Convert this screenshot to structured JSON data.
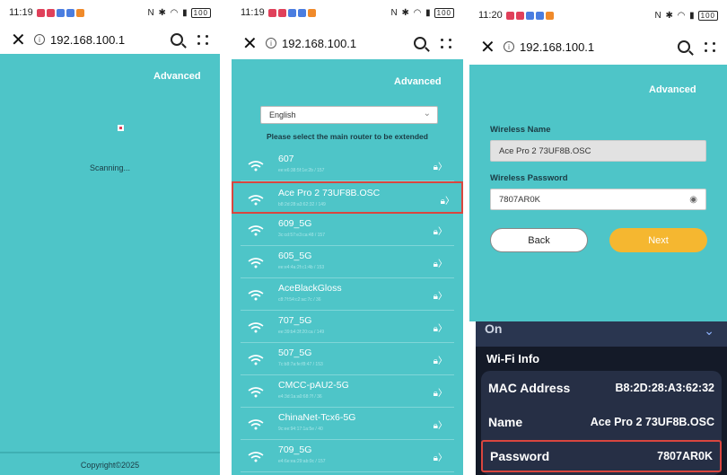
{
  "p1": {
    "time": "11:19",
    "url": "192.168.100.1",
    "advanced": "Advanced",
    "scanning": "Scanning...",
    "copyright": "Copyright©2025"
  },
  "p2": {
    "time": "11:19",
    "url": "192.168.100.1",
    "advanced": "Advanced",
    "language": "English",
    "prompt": "Please select the main router to be extended",
    "networks": [
      {
        "name": "607",
        "mac": "ee:e6:38:5f:1e:2b / 157"
      },
      {
        "name": "Ace Pro 2 73UF8B.OSC",
        "mac": "b8:2d:28:a3:62:32 / 149"
      },
      {
        "name": "609_5G",
        "mac": "3c:cd:57:e3:ca:48 / 157"
      },
      {
        "name": "605_5G",
        "mac": "ee:e4:4a:2f:c1:4b / 153"
      },
      {
        "name": "AceBlackGloss",
        "mac": "c8:7f:54:c2:ac:7c / 36"
      },
      {
        "name": "707_5G",
        "mac": "ee:39:b4:3f:20:ca / 149"
      },
      {
        "name": "507_5G",
        "mac": "7c:b8:7a:fe:f8:47 / 153"
      },
      {
        "name": "CMCC-pAU2-5G",
        "mac": "e4:3d:1a:a0:68:7f / 36"
      },
      {
        "name": "ChinaNet-Tcx6-5G",
        "mac": "9c:ee:94:17:1a:5e / 40"
      },
      {
        "name": "709_5G",
        "mac": "e4:6e:ea:29:ab:0c / 157"
      }
    ]
  },
  "p3": {
    "time": "11:20",
    "url": "192.168.100.1",
    "advanced": "Advanced",
    "wireless_name_label": "Wireless Name",
    "wireless_name_value": "Ace Pro 2 73UF8B.OSC",
    "wireless_password_label": "Wireless Password",
    "wireless_password_value": "7807AR0K",
    "back_label": "Back",
    "next_label": "Next"
  },
  "p4": {
    "on_label": "On",
    "section": "Wi-Fi Info",
    "mac_label": "MAC Address",
    "mac_value": "B8:2D:28:A3:62:32",
    "name_label": "Name",
    "name_value": "Ace Pro 2 73UF8B.OSC",
    "password_label": "Password",
    "password_value": "7807AR0K"
  },
  "colors": {
    "teal": "#4ec5c8",
    "next_button": "#f5b730",
    "highlight": "#d9463f"
  }
}
